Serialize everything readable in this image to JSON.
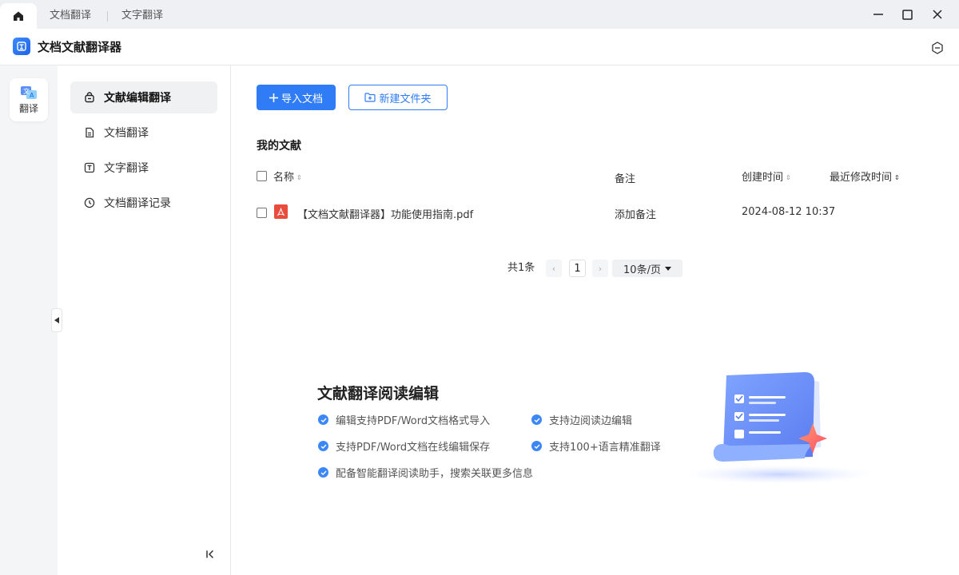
{
  "tabs": [
    {
      "label": "文档翻译"
    },
    {
      "label": "文字翻译"
    }
  ],
  "app": {
    "title": "文档文献翻译器"
  },
  "rail": {
    "label": "翻译"
  },
  "sidebar": {
    "items": [
      {
        "label": "文献编辑翻译",
        "icon": "lock-bag-icon",
        "active": true
      },
      {
        "label": "文档翻译",
        "icon": "document-icon"
      },
      {
        "label": "文字翻译",
        "icon": "text-t-icon"
      },
      {
        "label": "文档翻译记录",
        "icon": "clock-icon"
      }
    ]
  },
  "toolbar": {
    "import_label": "导入文档",
    "new_folder_label": "新建文件夹"
  },
  "section": {
    "title": "我的文献"
  },
  "table": {
    "columns": {
      "name": "名称",
      "note": "备注",
      "created": "创建时间",
      "modified": "最近修改时间"
    },
    "rows": [
      {
        "name": "【文档文献翻译器】功能使用指南.pdf",
        "note": "添加备注",
        "created": "2024-08-12 10:37",
        "modified": ""
      }
    ]
  },
  "pagination": {
    "total": "共1条",
    "page": "1",
    "page_size": "10条/页"
  },
  "promo": {
    "title": "文献翻译阅读编辑",
    "features": [
      "编辑支持PDF/Word文档格式导入",
      "支持边阅读边编辑",
      "支持PDF/Word文档在线编辑保存",
      "支持100+语言精准翻译",
      "配备智能翻译阅读助手，搜索关联更多信息"
    ]
  },
  "colors": {
    "accent": "#2f7cf6",
    "pdf": "#e94b3c"
  }
}
